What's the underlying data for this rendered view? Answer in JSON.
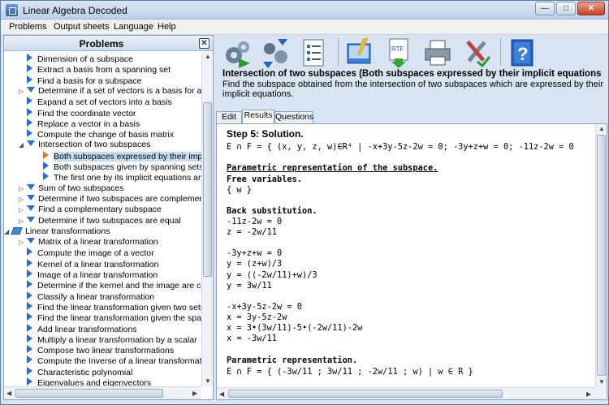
{
  "window": {
    "title": "Linear Algebra Decoded",
    "controls": [
      "minimize-icon",
      "maximize-icon",
      "close-icon"
    ]
  },
  "menu": [
    "Problems",
    "Output sheets",
    "Language",
    "Help"
  ],
  "left_panel": {
    "title": "Problems",
    "tree": [
      {
        "label": "Dimension of a subspace",
        "icon": "triangle-icon"
      },
      {
        "label": "Extract a basis from a spanning set",
        "icon": "triangle-icon"
      },
      {
        "label": "Find a basis for a subspace",
        "icon": "triangle-icon"
      },
      {
        "label": "Determine if a set of vectors is a basis for a sub",
        "icon": "folder-open-icon"
      },
      {
        "label": "Expand a set of vectors into a basis",
        "icon": "triangle-icon"
      },
      {
        "label": "Find the coordinate vector",
        "icon": "triangle-icon"
      },
      {
        "label": "Replace a vector in a basis",
        "icon": "triangle-icon"
      },
      {
        "label": "Compute the change of basis matrix",
        "icon": "triangle-icon"
      },
      {
        "label": "Intersection of two subspaces",
        "icon": "folder-open-icon"
      },
      {
        "label": "Both subspaces expressed by their implicit e",
        "icon": "triangle-icon",
        "selected": true
      },
      {
        "label": "Both subspaces given by spanning sets",
        "icon": "triangle-icon"
      },
      {
        "label": "The first one by its implicit equations and the",
        "icon": "triangle-icon"
      },
      {
        "label": "Sum of two subspaces",
        "icon": "folder-open-icon"
      },
      {
        "label": "Determine if two subspaces are complementary",
        "icon": "folder-open-icon"
      },
      {
        "label": "Find a complementary subspace",
        "icon": "folder-open-icon"
      },
      {
        "label": "Determine if two subspaces are equal",
        "icon": "folder-open-icon"
      },
      {
        "label": "Linear transformations",
        "icon": "book-icon"
      },
      {
        "label": "Matrix of a linear transformation",
        "icon": "folder-open-icon"
      },
      {
        "label": "Compute the image of a vector",
        "icon": "triangle-icon"
      },
      {
        "label": "Kernel of a linear transformation",
        "icon": "triangle-icon"
      },
      {
        "label": "Image of a linear transformation",
        "icon": "triangle-icon"
      },
      {
        "label": "Determine if the kernel and the image are compl",
        "icon": "triangle-icon"
      },
      {
        "label": "Classify a linear transformation",
        "icon": "triangle-icon"
      },
      {
        "label": "Find the linear transformation given two sets of",
        "icon": "triangle-icon"
      },
      {
        "label": "Find the linear transformation given the spannin",
        "icon": "triangle-icon"
      },
      {
        "label": "Add linear transformations",
        "icon": "triangle-icon"
      },
      {
        "label": "Multiply a linear transformation by a scalar",
        "icon": "triangle-icon"
      },
      {
        "label": "Compose two linear transformations",
        "icon": "triangle-icon"
      },
      {
        "label": "Compute the Inverse of a linear transformation",
        "icon": "triangle-icon"
      },
      {
        "label": "Characteristic polynomial",
        "icon": "triangle-icon"
      },
      {
        "label": "Eigenvalues and eigenvectors",
        "icon": "triangle-icon"
      }
    ]
  },
  "toolbar": {
    "tools": [
      "solve-gears-icon",
      "step-by-step-icon",
      "checklist-icon",
      "clear-brush-icon",
      "export-rtf-icon",
      "print-icon",
      "options-tools-icon",
      "help-book-icon"
    ],
    "rtf_label": "RTF"
  },
  "problem": {
    "title": "Intersection of two subspaces (Both subspaces expressed by their implicit equations",
    "description": "Find the subspace obtained from the intersection of two subspaces which are expressed by their implicit equations."
  },
  "tabs": [
    "Edit",
    "Results",
    "Questions"
  ],
  "active_tab": "Results",
  "results": [
    {
      "text": "Step 5: Solution.",
      "style": "heading"
    },
    {
      "text": "E ∩ F = { (x, y, z, w)∈R⁴ | -x+3y-5z-2w = 0; -3y+z+w = 0; -11z-2w = 0",
      "style": ""
    },
    {
      "text": "Parametric representation of the subspace.",
      "style": "bold under"
    },
    {
      "text": "Free variables.",
      "style": "bold"
    },
    {
      "text": "{ w }",
      "style": ""
    },
    {
      "text": "Back substitution.",
      "style": "bold"
    },
    {
      "text": "-11z-2w = 0",
      "style": ""
    },
    {
      "text": "z = -2w/11",
      "style": ""
    },
    {
      "text": "-3y+z+w = 0",
      "style": ""
    },
    {
      "text": "y = (z+w)/3",
      "style": ""
    },
    {
      "text": "y = ((-2w/11)+w)/3",
      "style": ""
    },
    {
      "text": "y = 3w/11",
      "style": ""
    },
    {
      "text": "-x+3y-5z-2w = 0",
      "style": ""
    },
    {
      "text": "x = 3y-5z-2w",
      "style": ""
    },
    {
      "text": "x = 3•(3w/11)-5•(-2w/11)-2w",
      "style": ""
    },
    {
      "text": "x = -3w/11",
      "style": ""
    },
    {
      "text": "Parametric representation.",
      "style": "bold"
    },
    {
      "text": "E ∩ F = { (-3w/11 ; 3w/11 ; -2w/11 ; w) | w ∈ R }",
      "style": ""
    }
  ]
}
